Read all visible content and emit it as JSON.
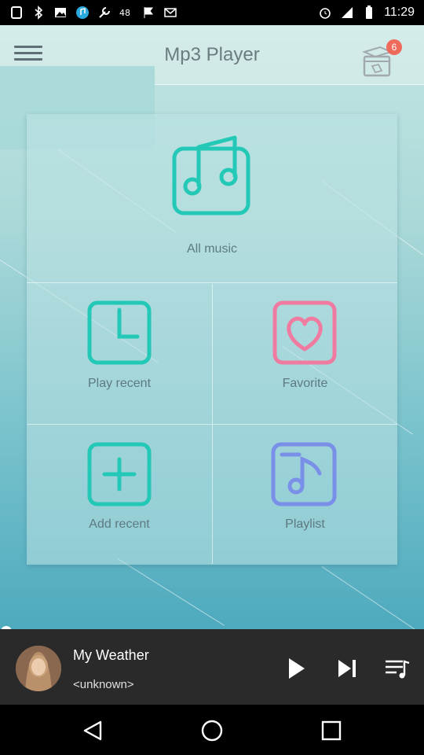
{
  "status_bar": {
    "time": "11:29",
    "icons": [
      "sim-icon",
      "bluetooth-icon",
      "image-icon",
      "music-icon",
      "wrench-icon",
      "48g-icon",
      "flag-icon",
      "mail-icon",
      "alarm-icon",
      "signal-icon",
      "battery-icon"
    ]
  },
  "app_bar": {
    "title": "Mp3 Player",
    "gift_badge_count": "6"
  },
  "menu": {
    "all_music_label": "All music",
    "play_recent_label": "Play recent",
    "favorite_label": "Favorite",
    "add_recent_label": "Add recent",
    "playlist_label": "Playlist"
  },
  "now_playing": {
    "title": "My Weather",
    "artist": "<unknown>"
  },
  "colors": {
    "teal_icon": "#23c9b6",
    "pink_icon": "#f07ba0",
    "purple_icon": "#7a8fe8"
  }
}
